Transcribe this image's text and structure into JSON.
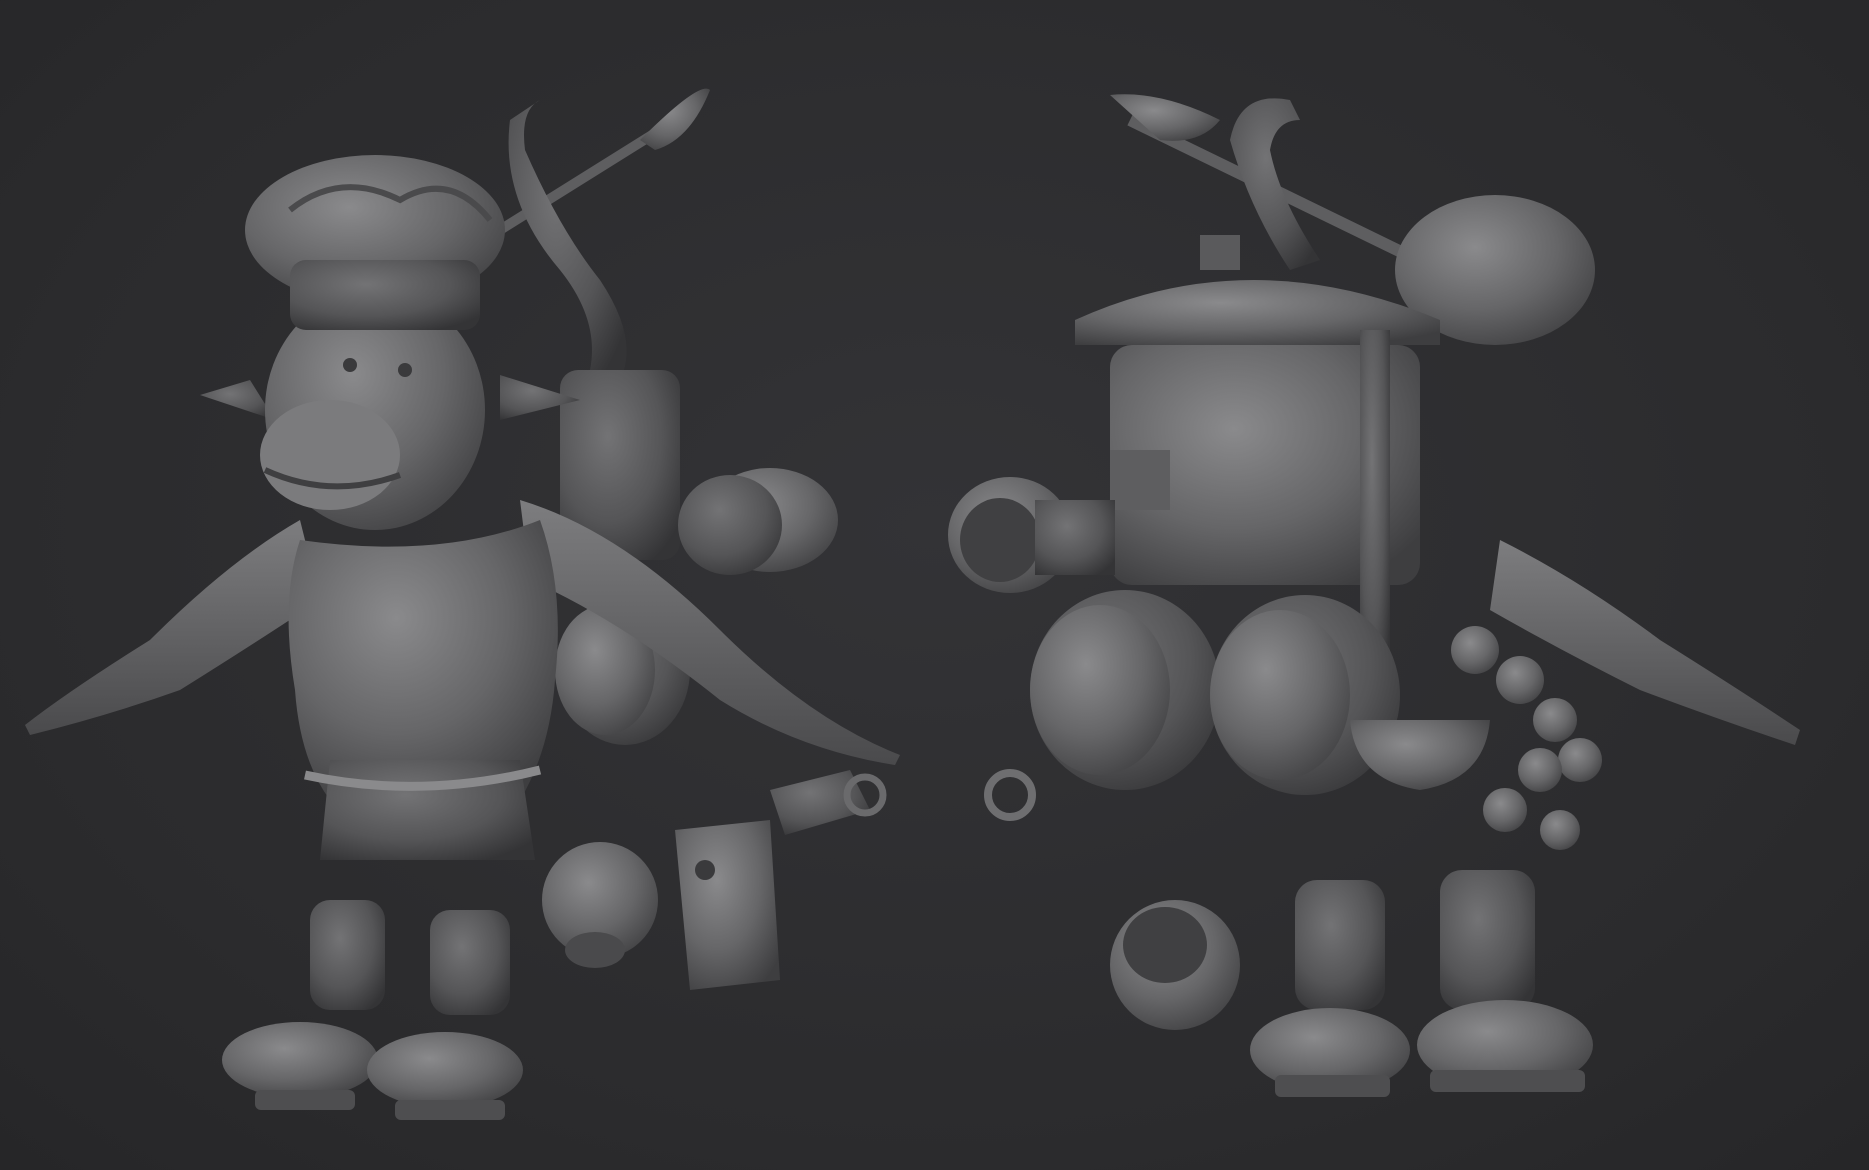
{
  "scene": {
    "background_color": "#2d2d2f",
    "model_color": "#6e6e70",
    "views": [
      {
        "id": "front",
        "subject": "goblin-chef-sculpt-front"
      },
      {
        "id": "back",
        "subject": "goblin-chef-sculpt-back"
      }
    ]
  }
}
